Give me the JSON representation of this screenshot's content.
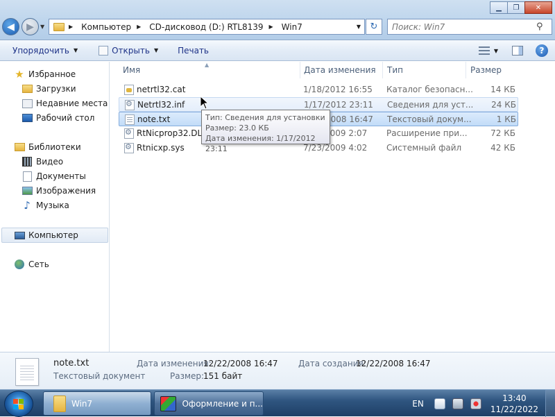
{
  "window": {
    "minimize": "▁",
    "maximize": "❐",
    "close": "✕"
  },
  "nav": {
    "back_glyph": "◀",
    "forward_glyph": "▶",
    "dropdown_glyph": "▼"
  },
  "address": {
    "crumbs": [
      "Компьютер",
      "CD-дисковод (D:) RTL8139",
      "Win7"
    ],
    "separator": "▶",
    "dropdown_glyph": "▼",
    "refresh_glyph": "↻"
  },
  "search": {
    "placeholder": "Поиск: Win7",
    "icon": "search-icon",
    "glyph": "⚲"
  },
  "toolbar": {
    "organize": "Упорядочить",
    "open": "Открыть",
    "print": "Печать",
    "arrow": "▼",
    "help": "?"
  },
  "navpane": {
    "favorites": "Избранное",
    "downloads": "Загрузки",
    "recent": "Недавние места",
    "desktop": "Рабочий стол",
    "libraries": "Библиотеки",
    "video": "Видео",
    "documents": "Документы",
    "pictures": "Изображения",
    "music": "Музыка",
    "computer": "Компьютер",
    "network": "Сеть"
  },
  "columns": {
    "name": "Имя",
    "date": "Дата изменения",
    "type": "Тип",
    "size": "Размер",
    "sort_glyph": "▲"
  },
  "files": [
    {
      "name": "netrtl32.cat",
      "date": "1/18/2012 16:55",
      "type": "Каталог безопасн...",
      "size": "14 КБ",
      "icon": "catalog-icon"
    },
    {
      "name": "Netrtl32.inf",
      "date": "1/17/2012 23:11",
      "type": "Сведения для уст...",
      "size": "24 КБ",
      "icon": "setup-info-icon"
    },
    {
      "name": "note.txt",
      "date": "2/22/2008 16:47",
      "type": "Текстовый докум...",
      "size": "1 КБ",
      "icon": "text-file-icon"
    },
    {
      "name": "RtNicprop32.DLL",
      "date": "7/14/2009 2:07",
      "type": "Расширение при...",
      "size": "72 КБ",
      "icon": "dll-file-icon"
    },
    {
      "name": "Rtnicxp.sys",
      "date": "7/23/2009 4:02",
      "type": "Системный файл",
      "size": "42 КБ",
      "icon": "system-file-icon"
    }
  ],
  "tooltip": {
    "type": "Тип: Сведения для установки",
    "size": "Размер: 23.0 КБ",
    "modified": "Дата изменения: 1/17/2012 23:11"
  },
  "details": {
    "filename": "note.txt",
    "filetype": "Текстовый документ",
    "modified_label": "Дата изменения:",
    "modified_value": "12/22/2008 16:47",
    "created_label": "Дата создания:",
    "created_value": "12/22/2008 16:47",
    "size_label": "Размер:",
    "size_value": "151 байт"
  },
  "taskbar": {
    "tasks": [
      "Win7",
      "Оформление и п..."
    ],
    "language": "EN",
    "time": "13:40",
    "date": "11/22/2022"
  }
}
